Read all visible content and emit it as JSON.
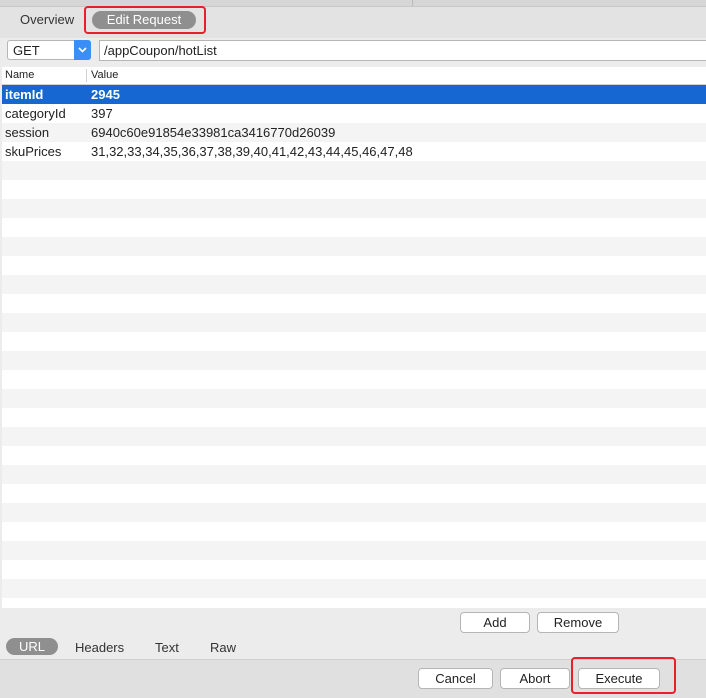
{
  "tabs": {
    "overview": "Overview",
    "edit_request": "Edit Request"
  },
  "request": {
    "method": "GET",
    "path": "/appCoupon/hotList"
  },
  "table": {
    "headers": {
      "name": "Name",
      "value": "Value"
    },
    "rows": [
      {
        "name": "itemId",
        "value": "2945",
        "selected": true
      },
      {
        "name": "categoryId",
        "value": "397"
      },
      {
        "name": "session",
        "value": "6940c60e91854e33981ca3416770d26039"
      },
      {
        "name": "skuPrices",
        "value": "31,32,33,34,35,36,37,38,39,40,41,42,43,44,45,46,47,48"
      }
    ]
  },
  "actions": {
    "add": "Add",
    "remove": "Remove"
  },
  "bottom_tabs": {
    "url": "URL",
    "headers": "Headers",
    "text": "Text",
    "raw": "Raw"
  },
  "footer": {
    "cancel": "Cancel",
    "abort": "Abort",
    "execute": "Execute"
  },
  "colors": {
    "selection": "#1667d1",
    "highlight": "#e8202a",
    "accent": "#3a8ef5"
  }
}
